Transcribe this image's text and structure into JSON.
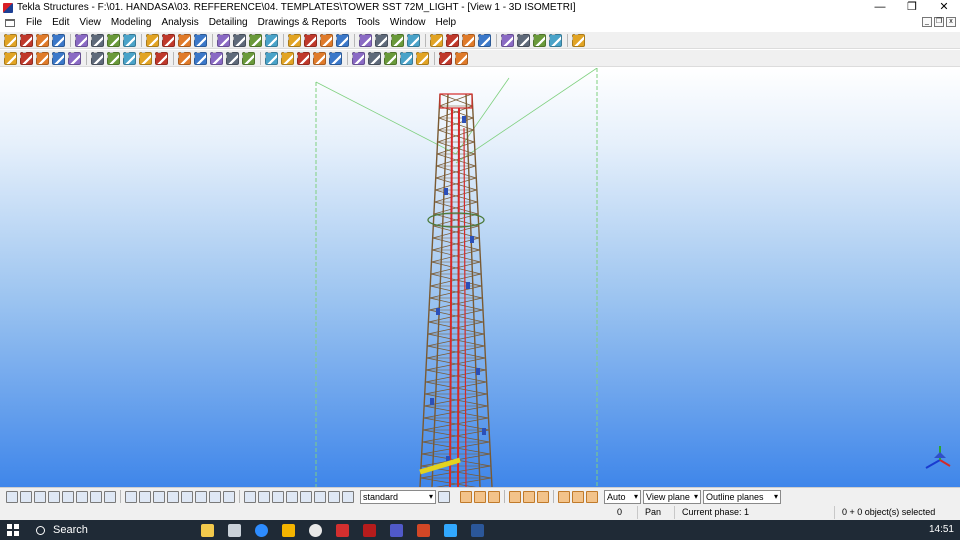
{
  "window": {
    "title": "Tekla Structures - F:\\01. HANDASA\\03. REFFERENCE\\04. TEMPLATES\\TOWER SST 72M_LIGHT - [View 1 - 3D ISOMETRI]",
    "minimize": "—",
    "restore": "❐",
    "close": "✕"
  },
  "menu": {
    "items": [
      "File",
      "Edit",
      "View",
      "Modeling",
      "Analysis",
      "Detailing",
      "Drawings & Reports",
      "Tools",
      "Window",
      "Help"
    ]
  },
  "toolbar1": {
    "icons": [
      "new-icon",
      "open-icon",
      "save-icon",
      "undo-icon",
      "redo-icon",
      "zoom-original-icon",
      "zoom-in-icon",
      "zoom-out-icon",
      "pan-icon",
      "view-properties-icon",
      "work-area-icon",
      "clip-plane-icon",
      "create-view-icon",
      "snapshot-icon",
      "model-folder-icon",
      "print-icon",
      "properties-icon",
      "rotate-icon",
      "move-icon",
      "copy-icon",
      "measure-icon",
      "grid-icon",
      "axis-icon",
      "point-icon",
      "arc-icon",
      "line-icon",
      "component-icon",
      "catalog-icon",
      "numbering-icon",
      "report-icon",
      "drawing-list-icon",
      "export-icon",
      "settings-icon"
    ]
  },
  "toolbar2": {
    "icons": [
      "beam-icon",
      "column-icon",
      "plate-icon",
      "slab-icon",
      "panel-icon",
      "bolt-icon",
      "weld-icon",
      "cut-icon",
      "fitting-icon",
      "polybeam-icon",
      "curved-beam-icon",
      "pad-footing-icon",
      "strip-footing-icon",
      "reinforcement-icon",
      "rebar-group-icon",
      "mesh-icon",
      "stirrup-icon",
      "surface-icon",
      "chamfer-icon",
      "select-all-icon",
      "snap-icon",
      "snap-midpoint-icon",
      "snap-endpoint-icon",
      "snap-intersection-icon",
      "snap-perpendicular-icon",
      "snap-free-icon",
      "snap-center-icon"
    ]
  },
  "viewport": {
    "view_name": "View 1 - 3D ISOMETRI",
    "background_top": "#ffffff",
    "background_bottom": "#3f86ea",
    "tower_main_color": "#d42a2a",
    "tower_lattice_color": "#7a5a32",
    "work_area_color": "#7fd07f"
  },
  "selection_toolbar": {
    "switch_icons": [
      "select-all-switch-icon",
      "select-parts-icon",
      "select-surfaces-icon",
      "select-points-icon",
      "select-grids-icon",
      "select-gridlines-icon",
      "select-welds-icon",
      "select-cuts-icon",
      "select-views-icon",
      "select-components-icon",
      "select-bolts-icon",
      "select-plane-icon",
      "select-reference-icon",
      "select-assembly-icon",
      "select-rebar-icon",
      "select-filter-icon",
      "select-objects-icon",
      "select-assemblies-icon",
      "select-groups-icon",
      "select-details-icon",
      "select-seams-icon",
      "select-connections-icon",
      "select-single-icon",
      "select-multiple-icon"
    ],
    "filter_value": "standard",
    "snap_icons": [
      "snap-ref-icon",
      "snap-geometry-icon",
      "snap-nearest-icon",
      "snap-line-icon",
      "snap-extension-icon",
      "snap-any-icon",
      "snap-grid-icon",
      "snap-override-icon",
      "snap-relative-icon"
    ],
    "plane_mode": "Auto",
    "plane_value": "View plane",
    "planes_display": "Outline planes"
  },
  "statusbar": {
    "coord": "0",
    "mode": "Pan",
    "phase": "Current phase: 1",
    "selection": "0 + 0 object(s) selected"
  },
  "taskbar": {
    "search": "Search",
    "apps": [
      "copilot-icon",
      "task-view-icon",
      "zoom-icon",
      "file-explorer-icon",
      "chrome-icon",
      "acrobat-icon",
      "tekla-icon",
      "teams-icon",
      "powerpoint-icon",
      "photoshop-icon",
      "word-icon"
    ],
    "time": "14:51"
  }
}
